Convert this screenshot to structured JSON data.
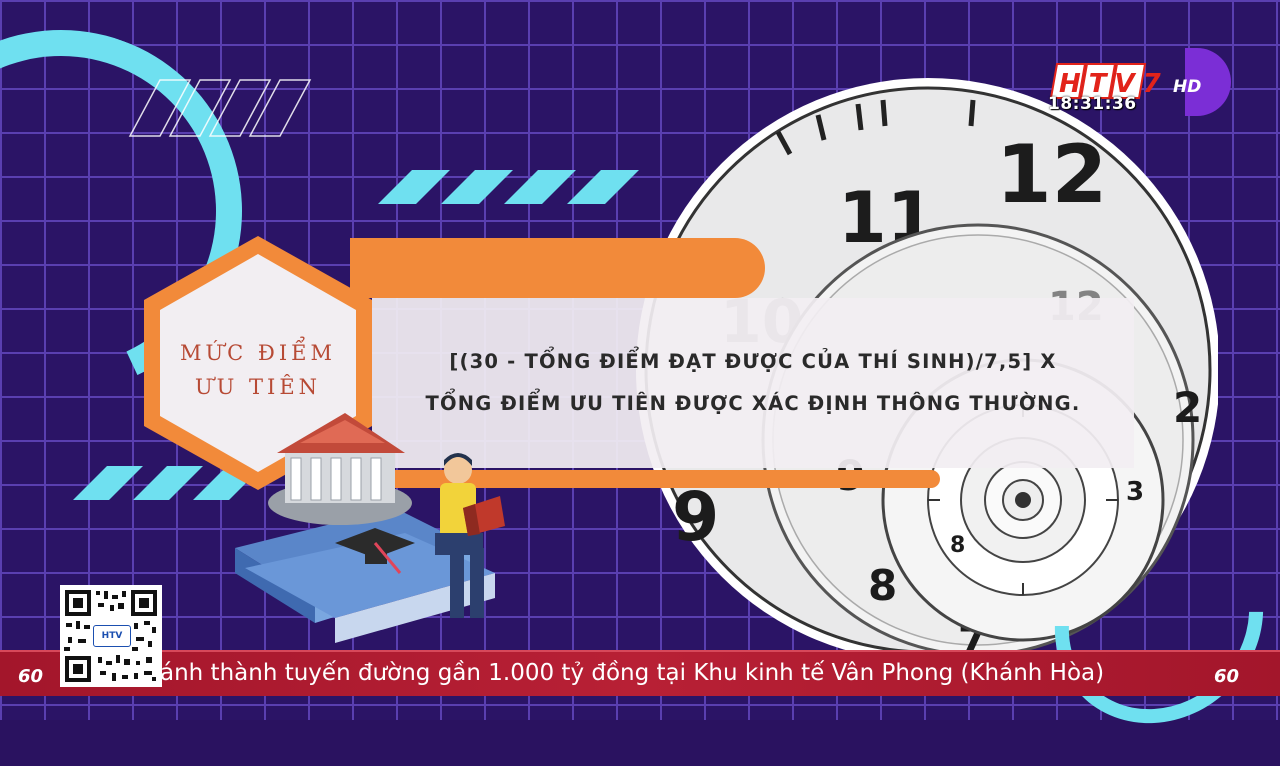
{
  "infographic": {
    "label_line1": "MỨC ĐIỂM",
    "label_line2": "ƯU TIÊN",
    "formula_line1": "[(30 - TỔNG ĐIỂM ĐẠT ĐƯỢC CỦA THÍ SINH)/7,5] X",
    "formula_line2": "TỔNG ĐIỂM ƯU TIÊN ĐƯỢC XÁC ĐỊNH THÔNG THƯỜNG."
  },
  "channel": {
    "logo_text": "HTV7",
    "logo_suffix": "HD",
    "time": "18:31:36"
  },
  "ticker": {
    "headline": "ánh thành tuyến đường gần 1.000 tỷ đồng tại Khu kinh tế Vân Phong (Khánh Hòa)"
  },
  "qr": {
    "center_label": "HTV"
  },
  "clock": {
    "numerals": [
      "11",
      "12",
      "10",
      "2",
      "9",
      "3",
      "8",
      "7"
    ]
  },
  "colors": {
    "background": "#2b1466",
    "grid": "#5a3fb0",
    "accent_cyan": "#6fe0f0",
    "accent_orange": "#f28a3a",
    "label_red": "#b74a35",
    "ticker_red": "#b82035"
  }
}
